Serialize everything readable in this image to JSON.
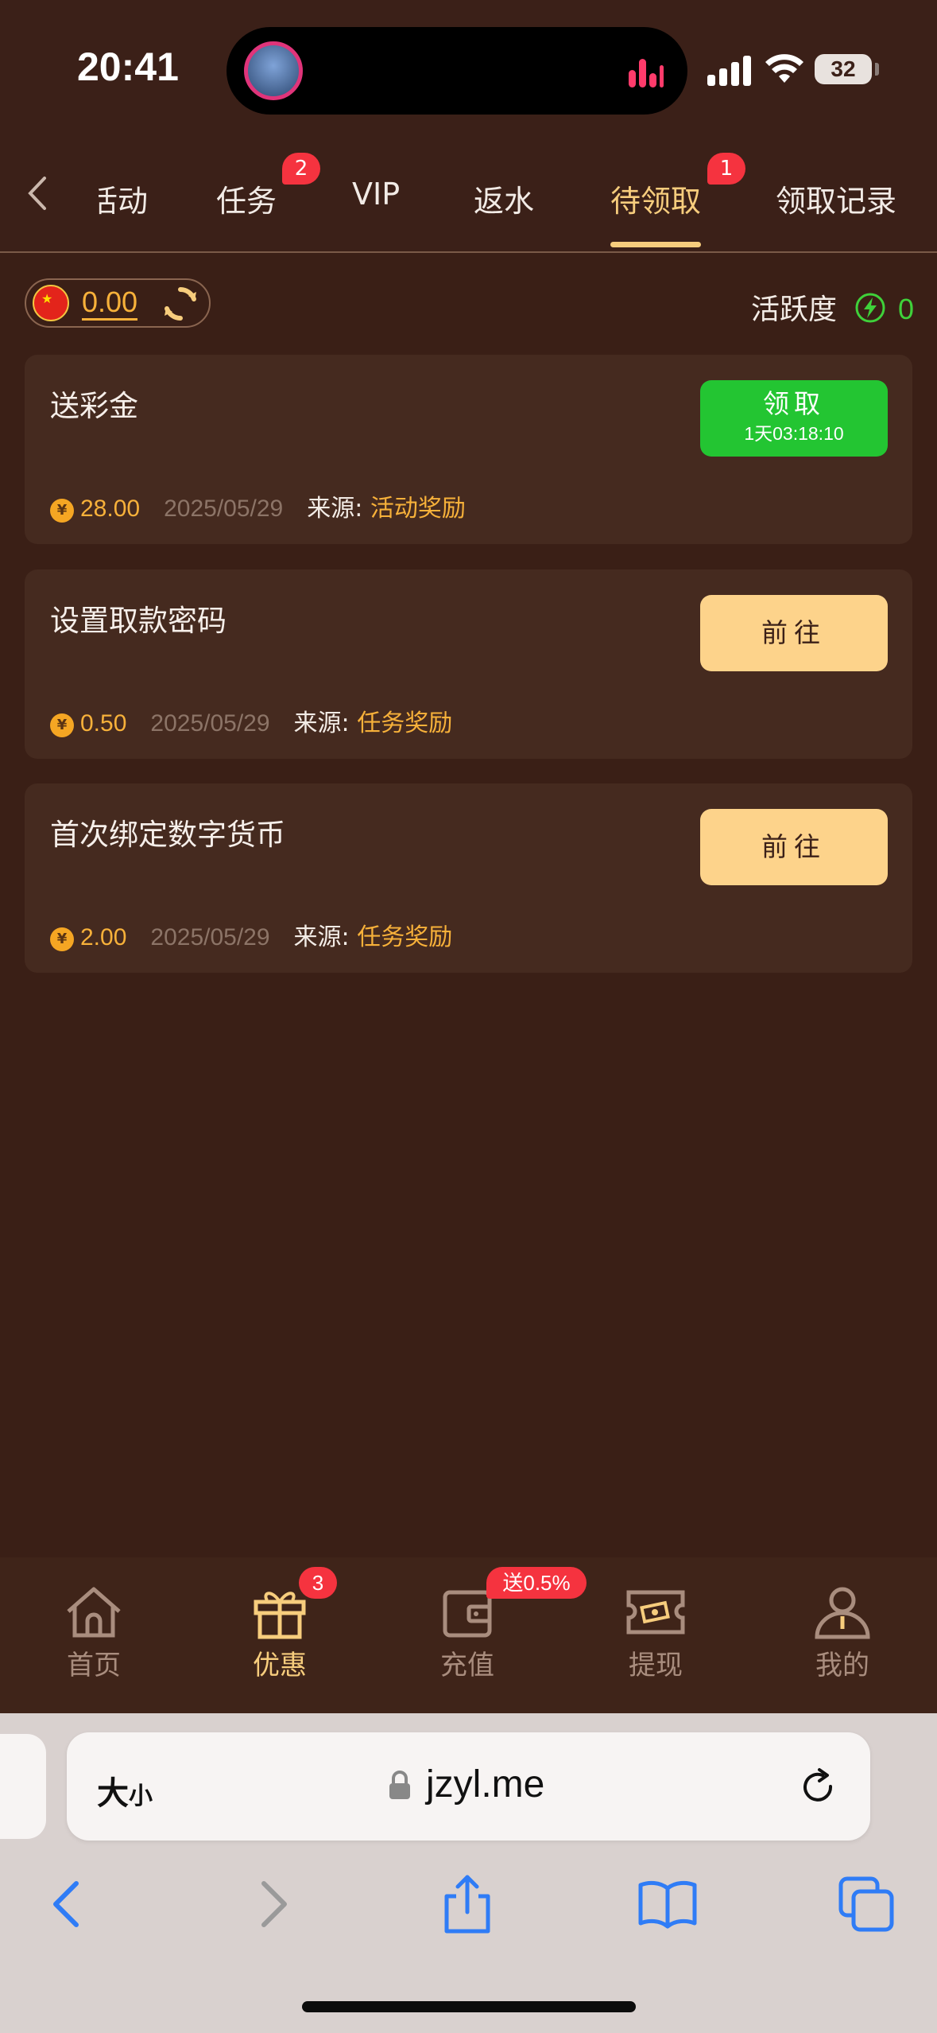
{
  "status_bar": {
    "time": "20:41",
    "battery": "32"
  },
  "tabs": {
    "items": [
      {
        "label": "活动",
        "badge": ""
      },
      {
        "label": "任务",
        "badge": "2"
      },
      {
        "label": "VIP",
        "badge": ""
      },
      {
        "label": "返水",
        "badge": ""
      },
      {
        "label": "待领取",
        "badge": "1",
        "active": true
      },
      {
        "label": "领取记录",
        "badge": ""
      }
    ]
  },
  "balance": {
    "value": "0.00"
  },
  "activity": {
    "label": "活跃度",
    "value": "0"
  },
  "cards": [
    {
      "title": "送彩金",
      "button": "领取",
      "countdown": "1天03:18:10",
      "amount": "28.00",
      "date": "2025/05/29",
      "source_label": "来源:",
      "source": "活动奖励"
    },
    {
      "title": "设置取款密码",
      "button": "前往",
      "amount": "0.50",
      "date": "2025/05/29",
      "source_label": "来源:",
      "source": "任务奖励"
    },
    {
      "title": "首次绑定数字货币",
      "button": "前往",
      "amount": "2.00",
      "date": "2025/05/29",
      "source_label": "来源:",
      "source": "任务奖励"
    }
  ],
  "coin_symbol": "¥",
  "bottom_nav": {
    "items": [
      {
        "label": "首页",
        "icon": "home-icon"
      },
      {
        "label": "优惠",
        "icon": "gift-icon",
        "badge": "3",
        "active": true
      },
      {
        "label": "充值",
        "icon": "wallet-icon",
        "badge": "送0.5%"
      },
      {
        "label": "提现",
        "icon": "ticket-icon"
      },
      {
        "label": "我的",
        "icon": "user-icon"
      }
    ]
  },
  "browser": {
    "text_size_big": "大",
    "text_size_small": "小",
    "url": "jzyl.me"
  },
  "colors": {
    "accent": "#f7cd7d",
    "claim_green": "#23c532",
    "badge_red": "#f5333f",
    "background": "#3a1f16"
  }
}
